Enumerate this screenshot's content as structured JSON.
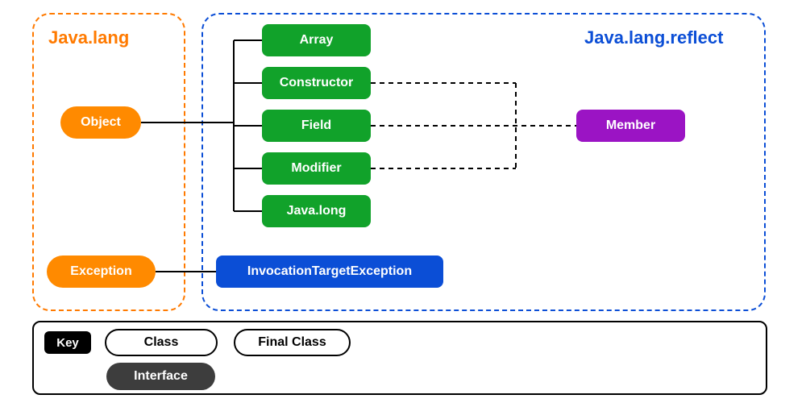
{
  "packages": {
    "lang": {
      "title": "Java.lang"
    },
    "reflect": {
      "title": "Java.lang.reflect"
    }
  },
  "nodes": {
    "object": "Object",
    "exception": "Exception",
    "greens": {
      "g1": "Array",
      "g2": "Constructor",
      "g3": "Field",
      "g4": "Modifier",
      "g5": "Java.long"
    },
    "member": "Member",
    "ite": "InvocationTargetException"
  },
  "key": {
    "label": "Key",
    "class": "Class",
    "finalClass": "Final Class",
    "interface": "Interface"
  },
  "colors": {
    "orange": "#ff8a00",
    "green": "#11a22a",
    "blue": "#0b4ed6",
    "purple": "#9b14c4"
  },
  "edges": {
    "solid": [
      {
        "from": "object",
        "to": [
          "g1",
          "g2",
          "g3",
          "g4",
          "g5"
        ]
      },
      {
        "from": "exception",
        "to": [
          "ite"
        ]
      }
    ],
    "dashed": [
      {
        "from": "member",
        "to": [
          "g2",
          "g3",
          "g4"
        ]
      }
    ]
  }
}
